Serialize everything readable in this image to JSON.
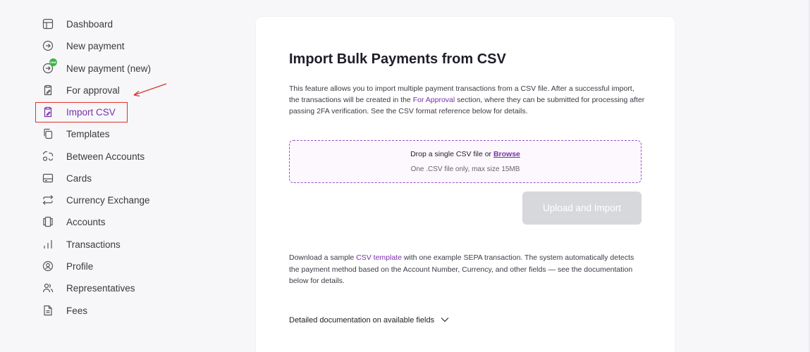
{
  "sidebar": {
    "items": [
      {
        "label": "Dashboard",
        "icon": "dashboard-icon"
      },
      {
        "label": "New payment",
        "icon": "arrow-circle-icon"
      },
      {
        "label": "New payment (new)",
        "icon": "arrow-circle-icon",
        "badge": "new"
      },
      {
        "label": "For approval",
        "icon": "clipboard-edit-icon"
      },
      {
        "label": "Import CSV",
        "icon": "clipboard-edit-icon",
        "active": true
      },
      {
        "label": "Templates",
        "icon": "copy-icon"
      },
      {
        "label": "Between Accounts",
        "icon": "swap-icon"
      },
      {
        "label": "Cards",
        "icon": "card-icon"
      },
      {
        "label": "Currency Exchange",
        "icon": "exchange-icon"
      },
      {
        "label": "Accounts",
        "icon": "accounts-icon"
      },
      {
        "label": "Transactions",
        "icon": "bars-icon"
      },
      {
        "label": "Profile",
        "icon": "user-circle-icon"
      },
      {
        "label": "Representatives",
        "icon": "users-icon"
      },
      {
        "label": "Fees",
        "icon": "document-icon"
      }
    ]
  },
  "colors": {
    "accent": "#7a2fa8",
    "annotation": "#e0312b",
    "badge": "#3bb54a",
    "disabled_button": "#d6d8dc"
  },
  "main": {
    "title": "Import Bulk Payments from CSV",
    "desc_part1": "This feature allows you to import multiple payment transactions from a CSV file. After a successful import, the transactions will be created in the ",
    "desc_link": "For Approval",
    "desc_part2": " section, where they can be submitted for processing after passing 2FA verification. See the CSV format reference below for details.",
    "dropzone": {
      "prefix": "Drop a single CSV file or ",
      "browse": "Browse",
      "hint": "One .CSV file only, max size 15MB"
    },
    "upload_button": "Upload and Import",
    "sample_part1": "Download a sample ",
    "sample_link": "CSV template",
    "sample_part2": " with one example SEPA transaction. The system automatically detects the payment method based on the Account Number, Currency, and other fields — see the documentation below for details.",
    "docs_toggle": "Detailed documentation on available fields"
  }
}
